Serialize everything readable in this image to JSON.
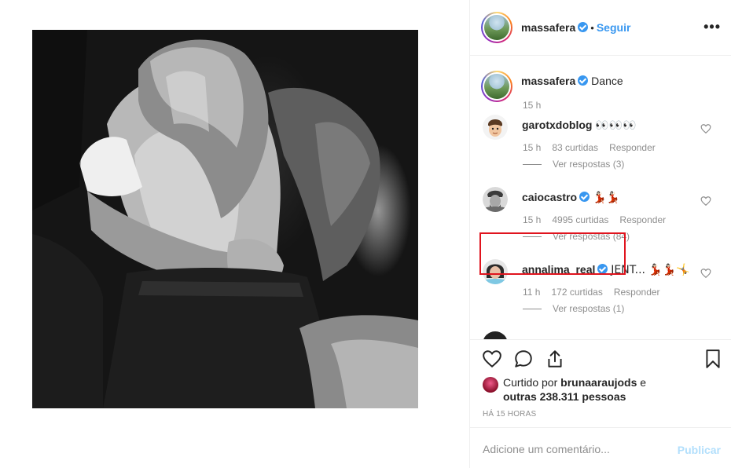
{
  "post": {
    "username": "massafera",
    "follow_label": "Seguir",
    "separator": "•",
    "more_label": "•••"
  },
  "caption": {
    "username": "massafera",
    "text": "Dance",
    "time": "15 h"
  },
  "comments": [
    {
      "username": "garotxdoblog",
      "text": "👀👀👀",
      "time": "15 h",
      "likes": "83 curtidas",
      "reply_label": "Responder",
      "view_replies": "Ver respostas (3)"
    },
    {
      "username": "caiocastro",
      "text": "💃🏻💃🏻",
      "time": "15 h",
      "likes": "4995 curtidas",
      "reply_label": "Responder",
      "view_replies": "Ver respostas (84)"
    },
    {
      "username": "annalima_real",
      "text": "JENT... 💃🏻💃🏻🤸",
      "time": "11 h",
      "likes": "172 curtidas",
      "reply_label": "Responder",
      "view_replies": "Ver respostas (1)"
    }
  ],
  "likes_summary": {
    "prefix": "Curtido por",
    "user": "brunaaraujods",
    "connector": "e",
    "others": "outras 238.311 pessoas"
  },
  "timestamp": "HÁ 15 HORAS",
  "add_comment": {
    "placeholder": "Adicione um comentário...",
    "publish_label": "Publicar"
  },
  "colors": {
    "accent": "#3897f0",
    "highlight": "#e0141e",
    "muted": "#8e8e8e",
    "publish_disabled": "#b2dffc"
  }
}
